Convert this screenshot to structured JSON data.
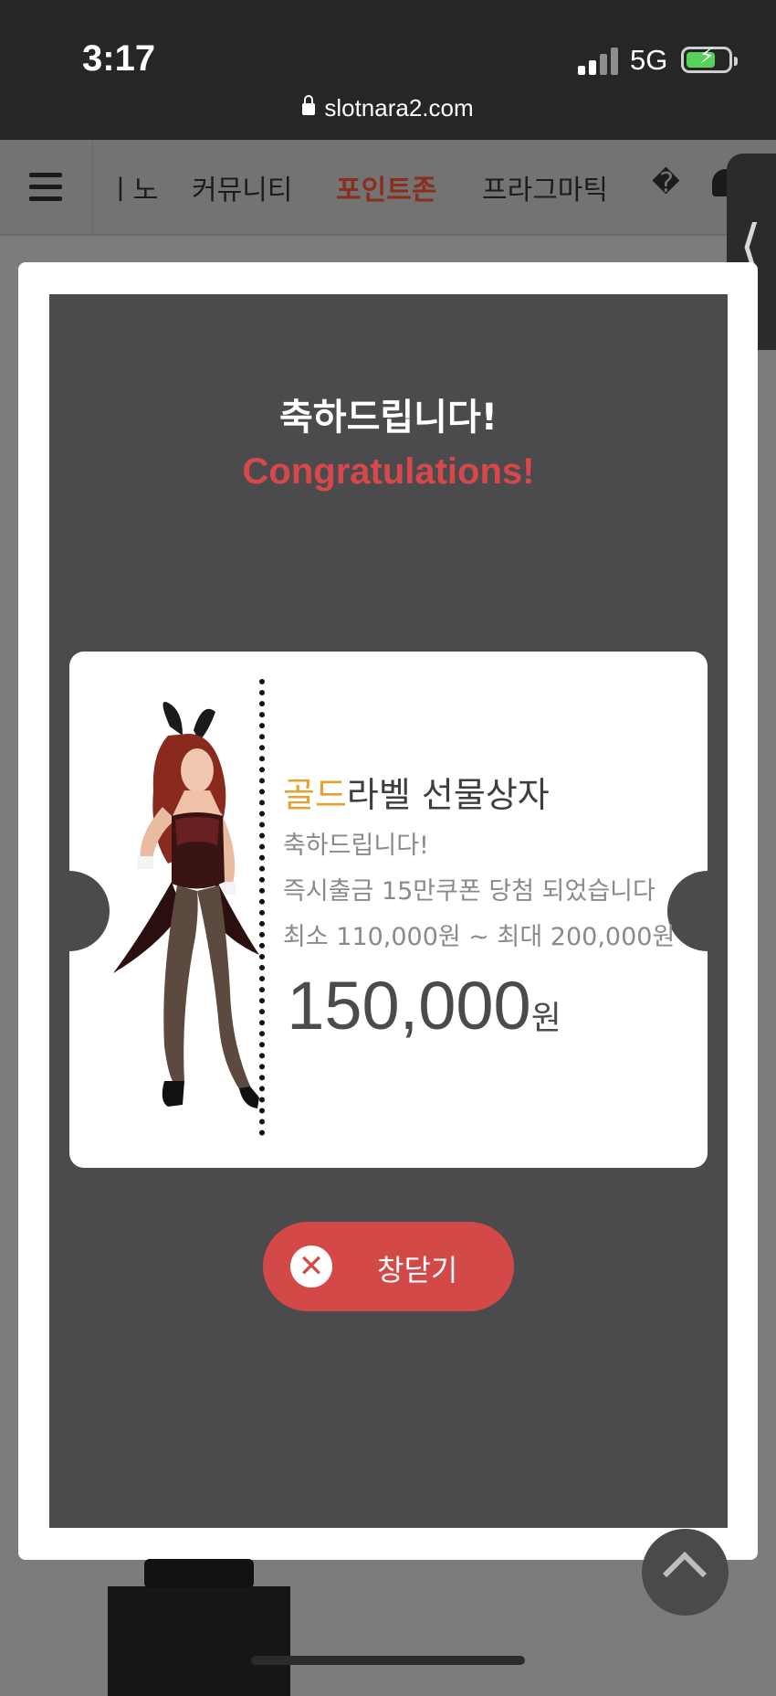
{
  "status_bar": {
    "time": "3:17",
    "network": "5G",
    "url": "slotnara2.com",
    "battery_level": 0.62
  },
  "site_nav": {
    "items": [
      {
        "label": "ㅣ노"
      },
      {
        "label": "커뮤니티"
      },
      {
        "label": "포인트존",
        "active": true
      },
      {
        "label": "프라그마틱"
      },
      {
        "label": "�"
      }
    ],
    "side_tab_label": "⟨"
  },
  "modal": {
    "title": "축하드립니다!",
    "subtitle": "Congratulations!",
    "coupon": {
      "title_highlight": "골드",
      "title_rest": "라벨 선물상자",
      "line1": "축하드립니다!",
      "line2": "즉시출금 15만쿠폰 당첨 되었습니다",
      "line3": "최소 110,000원 ~ 최대 200,000원",
      "amount": "150,000",
      "unit": "원"
    },
    "close_button": {
      "icon": "close-icon",
      "label": "창닫기"
    }
  },
  "colors": {
    "accent_red": "#d34948",
    "gold": "#e8a12e",
    "modal_bg": "#4b4b4d"
  }
}
